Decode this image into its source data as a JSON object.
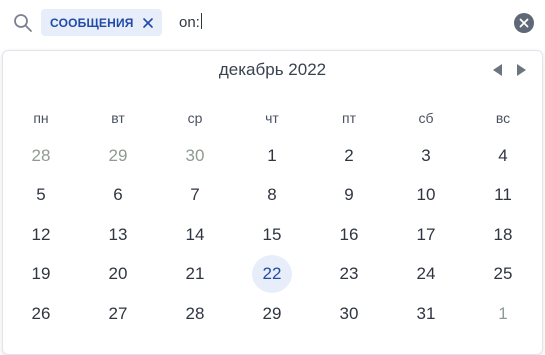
{
  "search": {
    "chip_label": "СООБЩЕНИЯ",
    "query": "on:"
  },
  "calendar": {
    "month_label": "декабрь 2022",
    "weekdays": [
      "пн",
      "вт",
      "ср",
      "чт",
      "пт",
      "сб",
      "вс"
    ],
    "weeks": [
      [
        "28",
        "29",
        "30",
        "1",
        "2",
        "3",
        "4"
      ],
      [
        "5",
        "6",
        "7",
        "8",
        "9",
        "10",
        "11"
      ],
      [
        "12",
        "13",
        "14",
        "15",
        "16",
        "17",
        "18"
      ],
      [
        "19",
        "20",
        "21",
        "22",
        "23",
        "24",
        "25"
      ],
      [
        "26",
        "27",
        "28",
        "29",
        "30",
        "31",
        "1"
      ]
    ],
    "selected_day": "22"
  },
  "colors": {
    "accent": "#1f4aa8",
    "chip_bg": "#e8eef9",
    "muted_day": "#8a939e"
  }
}
